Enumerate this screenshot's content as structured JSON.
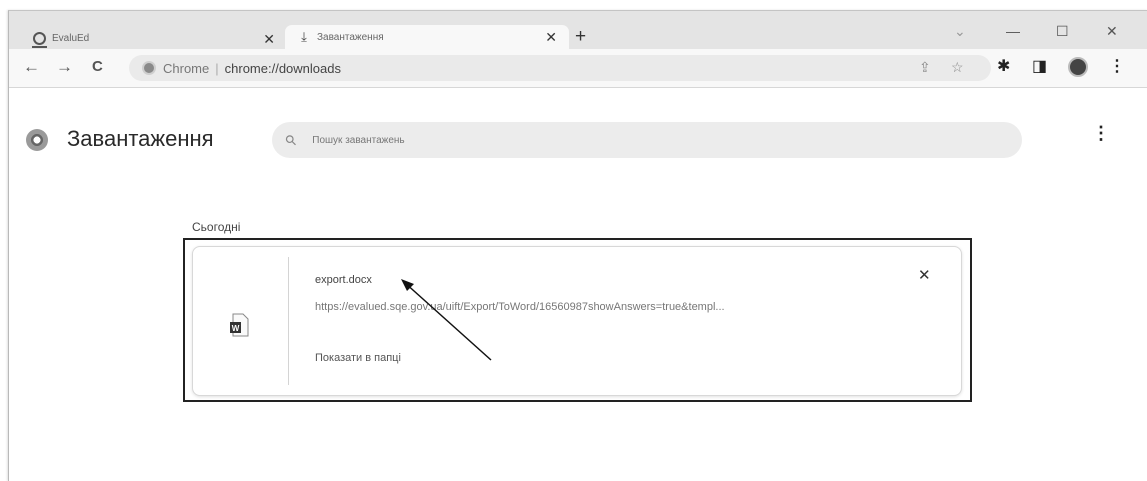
{
  "tabs": [
    {
      "title": "EvaluEd",
      "close": "✕"
    },
    {
      "title": "Завантаження",
      "close": "✕"
    }
  ],
  "new_tab_symbol": "+",
  "window_controls": {
    "chevron": "⌄",
    "minimize": "—",
    "maximize": "☐",
    "close": "✕"
  },
  "toolbar": {
    "back": "←",
    "forward": "→",
    "reload": "C",
    "chip_label": "Chrome",
    "separator": "|",
    "url": "chrome://downloads"
  },
  "page": {
    "title": "Завантаження",
    "search_placeholder": "Пошук завантажень",
    "menu": "⋮",
    "section_label": "Сьогодні"
  },
  "download": {
    "file_name": "export.docx",
    "url": "https://evalued.sqe.gov.ua/uift/Export/ToWord/16560987showAnswers=true&templ...",
    "show_in_folder": "Показати в папці",
    "remove": "✕",
    "file_icon_letter": "W"
  },
  "icons": {
    "share": "share-icon",
    "bookmark": "star-icon",
    "extensions": "puzzle-icon",
    "side_panel": "side-panel-icon",
    "profile": "avatar",
    "browser_menu": "more-vert-icon"
  }
}
